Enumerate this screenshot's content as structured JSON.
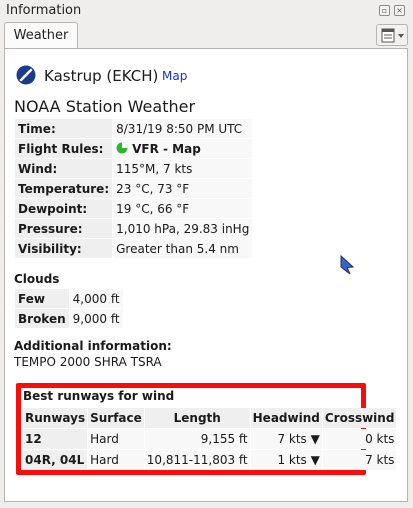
{
  "window": {
    "title": "Information"
  },
  "tabs": [
    {
      "label": "Weather"
    }
  ],
  "airport": {
    "name": "Kastrup (EKCH)",
    "link": "Map"
  },
  "noaa": {
    "title": "NOAA Station Weather",
    "rows": [
      {
        "label": "Time:",
        "value": "8/31/19 8:50 PM UTC"
      },
      {
        "label": "Flight Rules:",
        "value": "VFR - Map"
      },
      {
        "label": "Wind:",
        "value": "115°M, 7 kts"
      },
      {
        "label": "Temperature:",
        "value": "23 °C, 73 °F"
      },
      {
        "label": "Dewpoint:",
        "value": "19 °C, 66 °F"
      },
      {
        "label": "Pressure:",
        "value": "1,010 hPa, 29.83 inHg"
      },
      {
        "label": "Visibility:",
        "value": "Greater than 5.4 nm"
      }
    ]
  },
  "clouds": {
    "title": "Clouds",
    "rows": [
      {
        "label": "Few",
        "value": "4,000 ft"
      },
      {
        "label": "Broken",
        "value": "9,000 ft"
      }
    ]
  },
  "additional": {
    "title": "Additional information:",
    "text": "TEMPO 2000 SHRA TSRA"
  },
  "runways": {
    "title": "Best runways for wind",
    "headers": [
      "Runways",
      "Surface",
      "Length",
      "Headwind",
      "Crosswind"
    ],
    "rows": [
      {
        "runway": "12",
        "surface": "Hard",
        "length": "9,155 ft",
        "headwind": "7 kts ▼",
        "crosswind": "0 kts"
      },
      {
        "runway": "04R, 04L",
        "surface": "Hard",
        "length": "10,811-11,803 ft",
        "headwind": "1 kts ▼",
        "crosswind": "7 kts"
      }
    ]
  },
  "colors": {
    "highlight": "#ff0a0a",
    "link": "#1a2fc9",
    "vfr_green": "#2fb52f",
    "airport_icon": "#1e3a8a"
  },
  "icons": {
    "airport": "airport-runway-icon",
    "flight_rules": "vfr-status-icon",
    "tab_menu": "list-menu-icon",
    "float": "float-window-icon",
    "close": "close-icon"
  }
}
